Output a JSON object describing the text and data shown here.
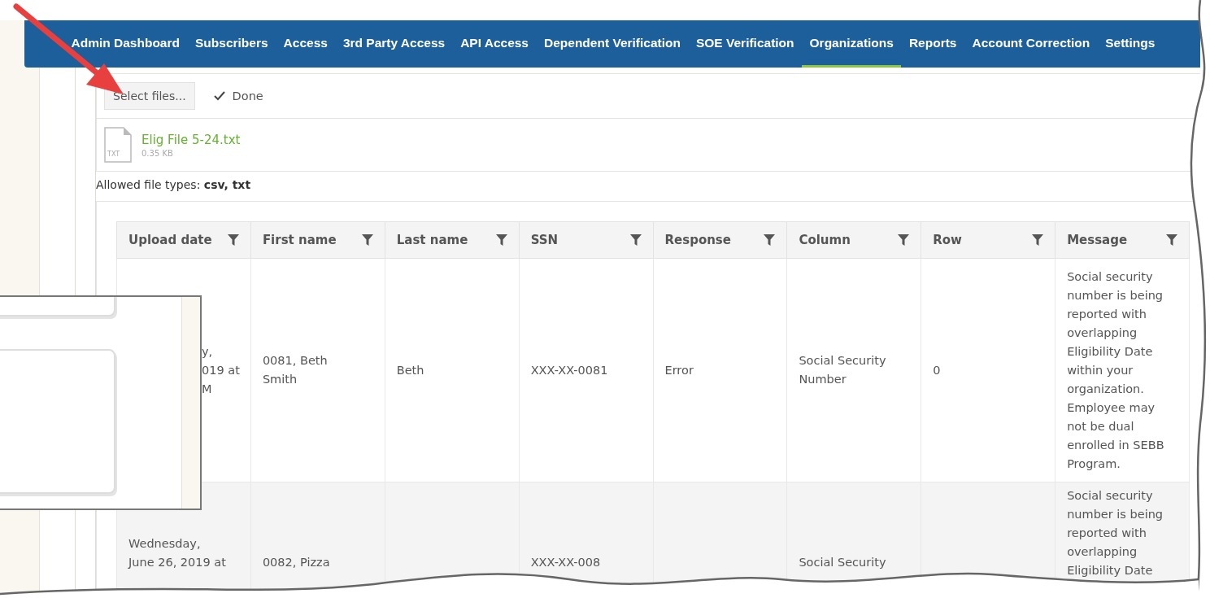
{
  "nav": {
    "items": [
      {
        "label": "Admin Dashboard",
        "selected": false
      },
      {
        "label": "Subscribers",
        "selected": false
      },
      {
        "label": "Access",
        "selected": false
      },
      {
        "label": "3rd Party Access",
        "selected": false
      },
      {
        "label": "API Access",
        "selected": false
      },
      {
        "label": "Dependent Verification",
        "selected": false
      },
      {
        "label": "SOE Verification",
        "selected": false
      },
      {
        "label": "Organizations",
        "selected": true
      },
      {
        "label": "Reports",
        "selected": false
      },
      {
        "label": "Account Correction",
        "selected": false
      },
      {
        "label": "Settings",
        "selected": false
      }
    ]
  },
  "upload": {
    "select_button": "Select files...",
    "status": "Done",
    "file": {
      "type_label": "TXT",
      "name": "Elig File 5-24.txt",
      "size": "0.35 KB"
    },
    "allowed": "Allowed file types: **csv, txt**"
  },
  "table": {
    "columns": [
      "Upload date",
      "First name",
      "Last name",
      "SSN",
      "Response",
      "Column",
      "Row",
      "Message"
    ],
    "rows": [
      {
        "cells": [
          "y,\n019 at\nM",
          "0081, Beth\nSmith",
          "Beth",
          "XXX-XX-0081",
          "Error",
          "Social Security\nNumber",
          "0",
          "Social security number is being reported with overlapping Eligibility Date within your organization. Employee may not be dual enrolled in SEBB Program."
        ]
      },
      {
        "cells": [
          "Wednesday,\nJune 26, 2019 at",
          "0082, Pizza",
          "",
          "XXX-XX-008",
          "",
          "Social Security",
          "",
          "Social security number is being reported with overlapping Eligibility Date"
        ]
      }
    ]
  }
}
